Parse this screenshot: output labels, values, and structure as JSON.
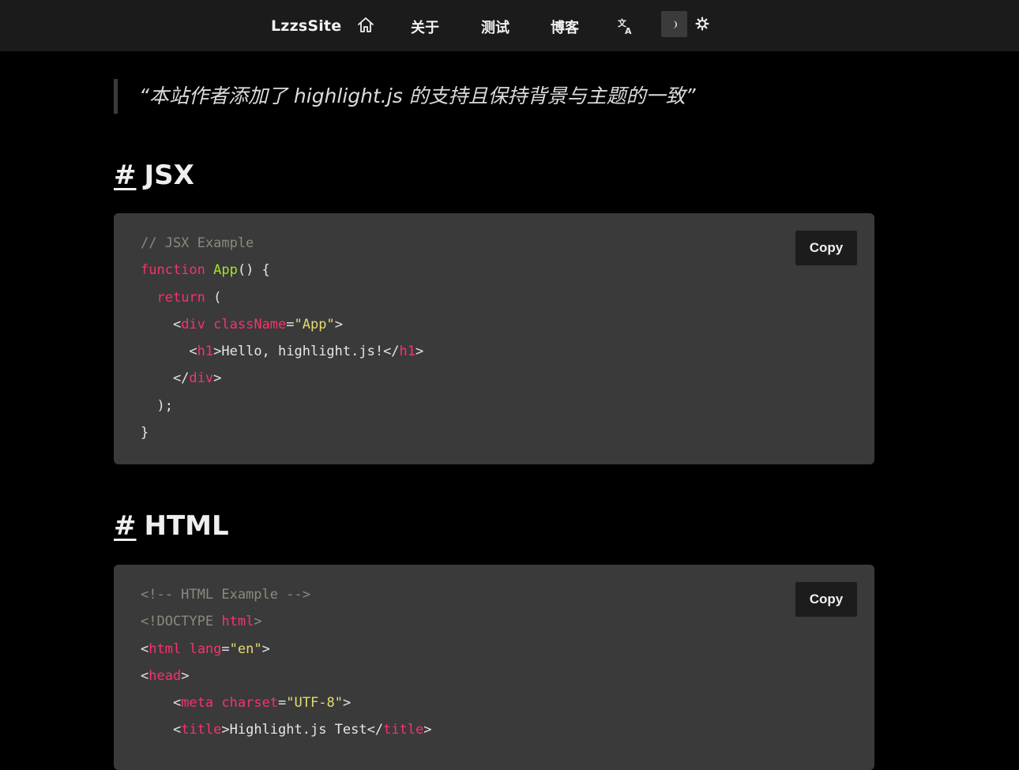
{
  "nav": {
    "brand": "LzzsSite",
    "home_icon": "home-icon",
    "links": [
      "关于",
      "测试",
      "博客"
    ],
    "translate_icon": "translate-icon",
    "dark_theme_icon": "moon-icon",
    "light_theme_icon": "gear-icon"
  },
  "quote": "“本站作者添加了 highlight.js 的支持且保持背景与主题的一致”",
  "sections": [
    {
      "hash": "#",
      "title": "JSX",
      "copy_label": "Copy",
      "code_lines": [
        [
          {
            "t": "// JSX Example",
            "c": "comment"
          }
        ],
        [
          {
            "t": "function ",
            "c": "kw"
          },
          {
            "t": "App",
            "c": "fn"
          },
          {
            "t": "() {",
            "c": "pl"
          }
        ],
        [
          {
            "t": "  ",
            "c": "pl"
          },
          {
            "t": "return",
            "c": "kw"
          },
          {
            "t": " (",
            "c": "pl"
          }
        ],
        [
          {
            "t": "    <",
            "c": "pl"
          },
          {
            "t": "div",
            "c": "tag"
          },
          {
            "t": " ",
            "c": "pl"
          },
          {
            "t": "className",
            "c": "attr"
          },
          {
            "t": "=",
            "c": "pl"
          },
          {
            "t": "\"App\"",
            "c": "str"
          },
          {
            "t": ">",
            "c": "pl"
          }
        ],
        [
          {
            "t": "      <",
            "c": "pl"
          },
          {
            "t": "h1",
            "c": "tag"
          },
          {
            "t": ">Hello, highlight.js!</",
            "c": "pl"
          },
          {
            "t": "h1",
            "c": "tag"
          },
          {
            "t": ">",
            "c": "pl"
          }
        ],
        [
          {
            "t": "    </",
            "c": "pl"
          },
          {
            "t": "div",
            "c": "tag"
          },
          {
            "t": ">",
            "c": "pl"
          }
        ],
        [
          {
            "t": "  );",
            "c": "pl"
          }
        ],
        [
          {
            "t": "}",
            "c": "pl"
          }
        ]
      ]
    },
    {
      "hash": "#",
      "title": "HTML",
      "copy_label": "Copy",
      "code_lines": [
        [
          {
            "t": "<!-- HTML Example -->",
            "c": "comment"
          }
        ],
        [
          {
            "t": "<!DOCTYPE ",
            "c": "comment"
          },
          {
            "t": "html",
            "c": "tag"
          },
          {
            "t": ">",
            "c": "comment"
          }
        ],
        [
          {
            "t": "<",
            "c": "pl"
          },
          {
            "t": "html",
            "c": "tag"
          },
          {
            "t": " ",
            "c": "pl"
          },
          {
            "t": "lang",
            "c": "attr"
          },
          {
            "t": "=",
            "c": "pl"
          },
          {
            "t": "\"en\"",
            "c": "str"
          },
          {
            "t": ">",
            "c": "pl"
          }
        ],
        [
          {
            "t": "<",
            "c": "pl"
          },
          {
            "t": "head",
            "c": "tag"
          },
          {
            "t": ">",
            "c": "pl"
          }
        ],
        [
          {
            "t": "    <",
            "c": "pl"
          },
          {
            "t": "meta",
            "c": "tag"
          },
          {
            "t": " ",
            "c": "pl"
          },
          {
            "t": "charset",
            "c": "attr"
          },
          {
            "t": "=",
            "c": "pl"
          },
          {
            "t": "\"UTF-8\"",
            "c": "str"
          },
          {
            "t": ">",
            "c": "pl"
          }
        ],
        [
          {
            "t": "    <",
            "c": "pl"
          },
          {
            "t": "title",
            "c": "tag"
          },
          {
            "t": ">Highlight.js Test</",
            "c": "pl"
          },
          {
            "t": "title",
            "c": "tag"
          },
          {
            "t": ">",
            "c": "pl"
          }
        ]
      ]
    }
  ],
  "colors": {
    "background": "#000000",
    "nav_background": "#1b1b1b",
    "code_background": "#3a3a3a",
    "keyword": "#f5336b",
    "function": "#a6e22e",
    "string": "#e6db74",
    "comment": "#8a8a7e"
  }
}
